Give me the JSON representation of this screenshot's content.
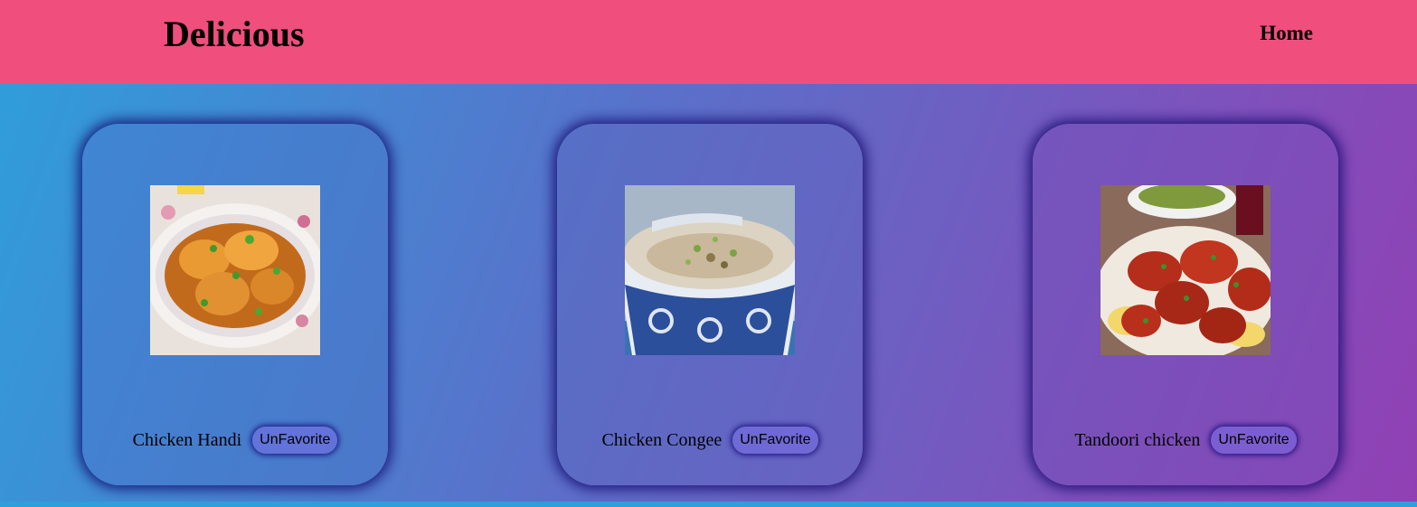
{
  "header": {
    "brand": "Delicious",
    "nav_home": "Home"
  },
  "cards": [
    {
      "name": "Chicken Handi",
      "button_label": "UnFavorite",
      "image": "chicken-handi-photo"
    },
    {
      "name": "Chicken Congee",
      "button_label": "UnFavorite",
      "image": "chicken-congee-photo"
    },
    {
      "name": "Tandoori chicken",
      "button_label": "UnFavorite",
      "image": "tandoori-chicken-photo"
    }
  ],
  "colors": {
    "header": "#f04e7d",
    "gradient_start": "#2e9fdb",
    "gradient_end": "#9140b4",
    "card_shadow": "#140a6e"
  }
}
